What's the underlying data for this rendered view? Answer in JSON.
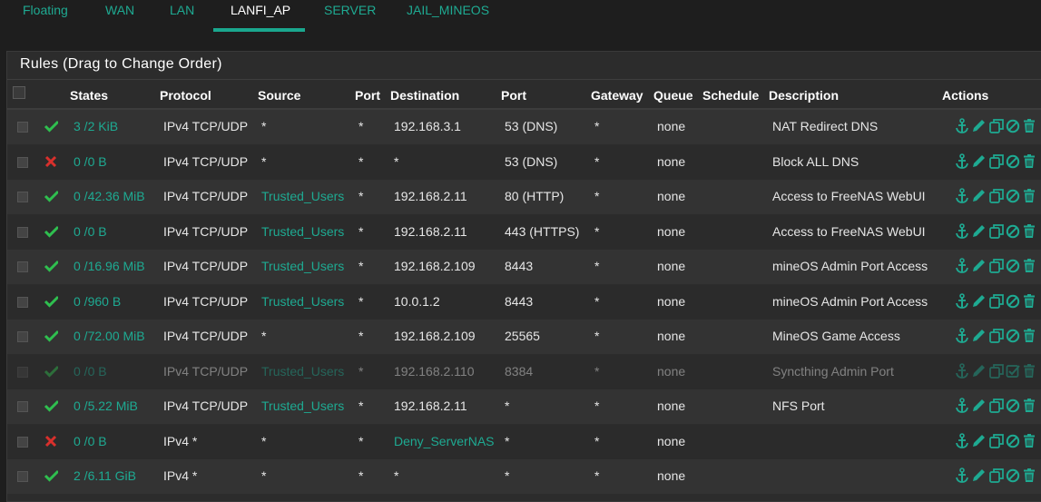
{
  "tabs": [
    "Floating",
    "WAN",
    "LAN",
    "LANFI_AP",
    "SERVER",
    "JAIL_MINEOS"
  ],
  "active_tab": "LANFI_AP",
  "panel_title": "Rules (Drag to Change Order)",
  "columns": [
    "States",
    "Protocol",
    "Source",
    "Port",
    "Destination",
    "Port",
    "Gateway",
    "Queue",
    "Schedule",
    "Description",
    "Actions"
  ],
  "colors": {
    "accent": "#1eaa92",
    "pass": "#2fbf4f",
    "block": "#d9302c",
    "bg": "#1e1e1e"
  },
  "rules": [
    {
      "status": "pass",
      "states": "3 /2 KiB",
      "protocol": "IPv4 TCP/UDP",
      "source": "*",
      "source_link": false,
      "sport": "*",
      "destination": "192.168.3.1",
      "dest_link": false,
      "dport": "53 (DNS)",
      "gateway": "*",
      "queue": "none",
      "schedule": "",
      "description": "NAT Redirect DNS",
      "disabled": false
    },
    {
      "status": "block",
      "states": "0 /0 B",
      "protocol": "IPv4 TCP/UDP",
      "source": "*",
      "source_link": false,
      "sport": "*",
      "destination": "*",
      "dest_link": false,
      "dport": "53 (DNS)",
      "gateway": "*",
      "queue": "none",
      "schedule": "",
      "description": "Block ALL DNS",
      "disabled": false
    },
    {
      "status": "pass",
      "states": "0 /42.36 MiB",
      "protocol": "IPv4 TCP/UDP",
      "source": "Trusted_Users",
      "source_link": true,
      "sport": "*",
      "destination": "192.168.2.11",
      "dest_link": false,
      "dport": "80 (HTTP)",
      "gateway": "*",
      "queue": "none",
      "schedule": "",
      "description": "Access to FreeNAS WebUI",
      "disabled": false
    },
    {
      "status": "pass",
      "states": "0 /0 B",
      "protocol": "IPv4 TCP/UDP",
      "source": "Trusted_Users",
      "source_link": true,
      "sport": "*",
      "destination": "192.168.2.11",
      "dest_link": false,
      "dport": "443 (HTTPS)",
      "gateway": "*",
      "queue": "none",
      "schedule": "",
      "description": "Access to FreeNAS WebUI",
      "disabled": false
    },
    {
      "status": "pass",
      "states": "0 /16.96 MiB",
      "protocol": "IPv4 TCP/UDP",
      "source": "Trusted_Users",
      "source_link": true,
      "sport": "*",
      "destination": "192.168.2.109",
      "dest_link": false,
      "dport": "8443",
      "gateway": "*",
      "queue": "none",
      "schedule": "",
      "description": "mineOS Admin Port Access",
      "disabled": false
    },
    {
      "status": "pass",
      "states": "0 /960 B",
      "protocol": "IPv4 TCP/UDP",
      "source": "Trusted_Users",
      "source_link": true,
      "sport": "*",
      "destination": "10.0.1.2",
      "dest_link": false,
      "dport": "8443",
      "gateway": "*",
      "queue": "none",
      "schedule": "",
      "description": "mineOS Admin Port Access",
      "disabled": false
    },
    {
      "status": "pass",
      "states": "0 /72.00 MiB",
      "protocol": "IPv4 TCP/UDP",
      "source": "*",
      "source_link": false,
      "sport": "*",
      "destination": "192.168.2.109",
      "dest_link": false,
      "dport": "25565",
      "gateway": "*",
      "queue": "none",
      "schedule": "",
      "description": "MineOS Game Access",
      "disabled": false
    },
    {
      "status": "pass",
      "states": "0 /0 B",
      "protocol": "IPv4 TCP/UDP",
      "source": "Trusted_Users",
      "source_link": true,
      "sport": "*",
      "destination": "192.168.2.110",
      "dest_link": false,
      "dport": "8384",
      "gateway": "*",
      "queue": "none",
      "schedule": "",
      "description": "Syncthing Admin Port",
      "disabled": true
    },
    {
      "status": "pass",
      "states": "0 /5.22 MiB",
      "protocol": "IPv4 TCP/UDP",
      "source": "Trusted_Users",
      "source_link": true,
      "sport": "*",
      "destination": "192.168.2.11",
      "dest_link": false,
      "dport": "*",
      "gateway": "*",
      "queue": "none",
      "schedule": "",
      "description": "NFS Port",
      "disabled": false
    },
    {
      "status": "block",
      "states": "0 /0 B",
      "protocol": "IPv4 *",
      "source": "*",
      "source_link": false,
      "sport": "*",
      "destination": "Deny_ServerNAS",
      "dest_link": true,
      "dport": "*",
      "gateway": "*",
      "queue": "none",
      "schedule": "",
      "description": "",
      "disabled": false
    },
    {
      "status": "pass",
      "states": "2 /6.11 GiB",
      "protocol": "IPv4 *",
      "source": "*",
      "source_link": false,
      "sport": "*",
      "destination": "*",
      "dest_link": false,
      "dport": "*",
      "gateway": "*",
      "queue": "none",
      "schedule": "",
      "description": "",
      "disabled": false
    }
  ],
  "action_icons": [
    "anchor-icon",
    "pencil-icon",
    "copy-icon",
    "disable-icon",
    "trash-icon"
  ]
}
